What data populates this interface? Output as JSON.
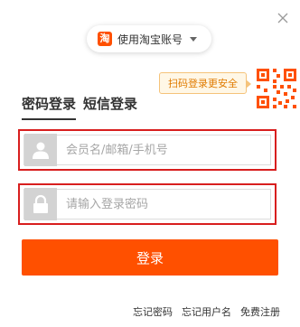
{
  "account_switch": {
    "logo_text": "淘",
    "label": "使用淘宝账号"
  },
  "qr": {
    "tip": "扫码登录更安全",
    "icon": "qr-code-icon"
  },
  "tabs": [
    {
      "label": "密码登录",
      "active": true
    },
    {
      "label": "短信登录",
      "active": false
    }
  ],
  "form": {
    "username_placeholder": "会员名/邮箱/手机号",
    "username_value": "",
    "password_placeholder": "请输入登录密码",
    "password_value": ""
  },
  "login_button": "登录",
  "footer": {
    "forgot_password": "忘记密码",
    "forgot_username": "忘记用户名",
    "register": "免费注册"
  },
  "colors": {
    "accent": "#ff5000",
    "error_border": "#d81e1e",
    "tip_text": "#e07b00"
  }
}
